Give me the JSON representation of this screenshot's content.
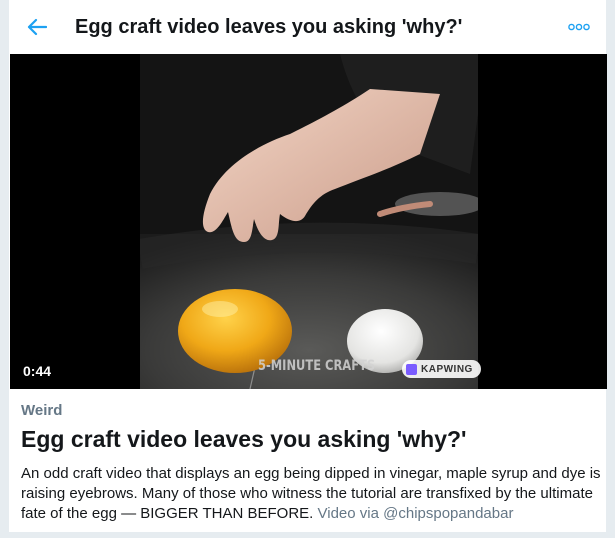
{
  "header": {
    "title": "Egg craft video leaves you asking 'why?'",
    "back_icon": "arrow-left-icon",
    "more_icon": "more-options-icon",
    "accent_color": "#1da1f2"
  },
  "media": {
    "duration": "0:44",
    "watermark_text": "5-MINUTE CRAFTS",
    "kapwing_text": "KAPWING"
  },
  "moment": {
    "category": "Weird",
    "headline": "Egg craft video leaves you asking 'why?'",
    "description": "An odd craft video that displays an egg being dipped in vinegar, maple syrup and dye is raising eyebrows. Many of those who witness the tutorial are transfixed by the ultimate fate of the egg — BIGGER THAN BEFORE.",
    "source": "Video via @chipspopandabar"
  }
}
